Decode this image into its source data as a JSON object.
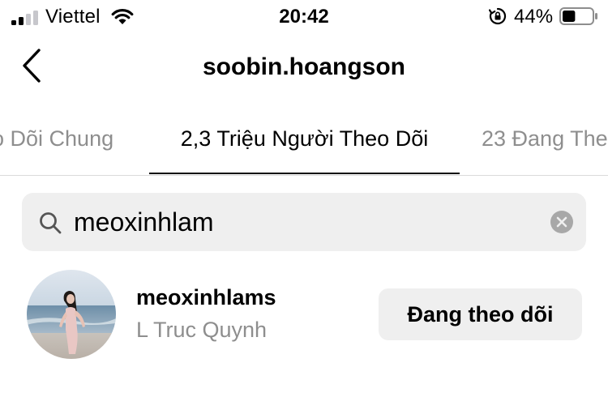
{
  "status_bar": {
    "carrier": "Viettel",
    "time": "20:42",
    "battery_percent": "44%",
    "battery_level": 0.44,
    "icons": [
      "signal-icon",
      "wifi-icon",
      "rotation-lock-icon",
      "battery-icon"
    ]
  },
  "header": {
    "title": "soobin.hoangson",
    "back_icon": "back-chevron-icon"
  },
  "tabs": [
    {
      "label": "o Dõi Chung",
      "active": false
    },
    {
      "label": "2,3 Triệu Người Theo Dõi",
      "active": true
    },
    {
      "label": "23 Đang The",
      "active": false
    }
  ],
  "search": {
    "value": "meoxinhlam",
    "icons": [
      "search-icon",
      "clear-icon"
    ]
  },
  "results": [
    {
      "username": "meoxinhlams",
      "full_name": "L Truc Quynh",
      "button_label": "Đang theo dõi"
    }
  ],
  "colors": {
    "text_primary": "#000000",
    "text_secondary": "#8e8e8e",
    "field_background": "#efefef",
    "divider": "#dbdbdb"
  }
}
